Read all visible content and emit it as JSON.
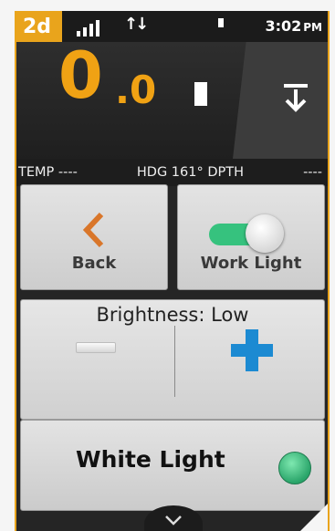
{
  "status_bar": {
    "badge": "2d",
    "data_arrows": "↑↓",
    "time": "3:02",
    "ampm": "PM"
  },
  "speed": {
    "integer": "0",
    "decimal": ".0"
  },
  "info_bar": {
    "temp": "TEMP ----",
    "heading": "HDG 161° DPTH",
    "depth": "----"
  },
  "buttons": {
    "back_label": "Back",
    "work_light_label": "Work Light",
    "work_light_on": true
  },
  "brightness": {
    "label": "Brightness: Low"
  },
  "white_light": {
    "label": "White Light",
    "active": true
  },
  "colors": {
    "accent": "#e9a41c",
    "speed": "#f0a214",
    "toggle_on": "#36c27e",
    "plus": "#1c8ad2",
    "back_arrow": "#d9762a"
  },
  "icons": {
    "download": "download-to-line-icon",
    "back": "chevron-left-icon",
    "scroll": "chevron-down-icon"
  }
}
